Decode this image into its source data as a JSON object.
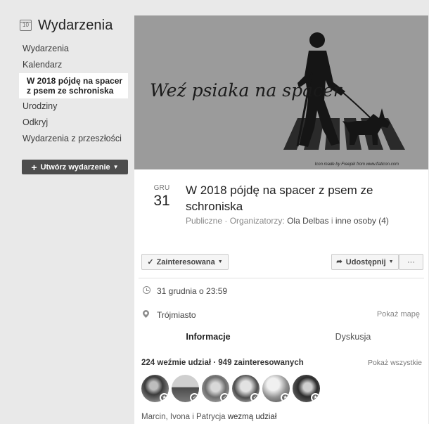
{
  "sidebar": {
    "title": "Wydarzenia",
    "calendar_icon_day": "10",
    "items": [
      {
        "label": "Wydarzenia"
      },
      {
        "label": "Kalendarz"
      },
      {
        "label": "W 2018 pójdę na spacer z psem ze schroniska"
      },
      {
        "label": "Urodziny"
      },
      {
        "label": "Odkryj"
      },
      {
        "label": "Wydarzenia z przeszłości"
      }
    ],
    "create_button": "Utwórz wydarzenie"
  },
  "cover": {
    "text": "Weź psiaka na spacer",
    "credit": "Icon made by Freepik from www.flaticon.com"
  },
  "event": {
    "month": "GRU",
    "day": "31",
    "title": "W 2018 pójdę na spacer z psem ze schroniska",
    "privacy": "Publiczne",
    "organizers_label": "Organizatorzy:",
    "organizer": "Ola Delbas",
    "others_sep": "i",
    "others": "inne osoby (4)"
  },
  "actions": {
    "interested": "Zainteresowana",
    "share": "Udostępnij",
    "more": "···"
  },
  "details": {
    "datetime": "31 grudnia o 23:59",
    "location": "Trójmiasto",
    "map_link": "Pokaż mapę"
  },
  "tabs": {
    "info": "Informacje",
    "discussion": "Dyskusja"
  },
  "attendance": {
    "summary": "224 weźmie udział · 949 zainteresowanych",
    "show_all": "Pokaż wszystkie",
    "names": "Marcin, Ivona i Patrycja",
    "names_suffix": "wezmą udział",
    "avatars": [
      {
        "badge": "star"
      },
      {
        "badge": "check"
      },
      {
        "badge": "check"
      },
      {
        "badge": "check"
      },
      {
        "badge": "star"
      },
      {
        "badge": "star"
      }
    ]
  },
  "icons": {
    "calendar": "calendar-icon",
    "clock": "clock-icon",
    "pin": "location-pin-icon",
    "share": "share-arrow-icon",
    "check": "check-icon"
  }
}
